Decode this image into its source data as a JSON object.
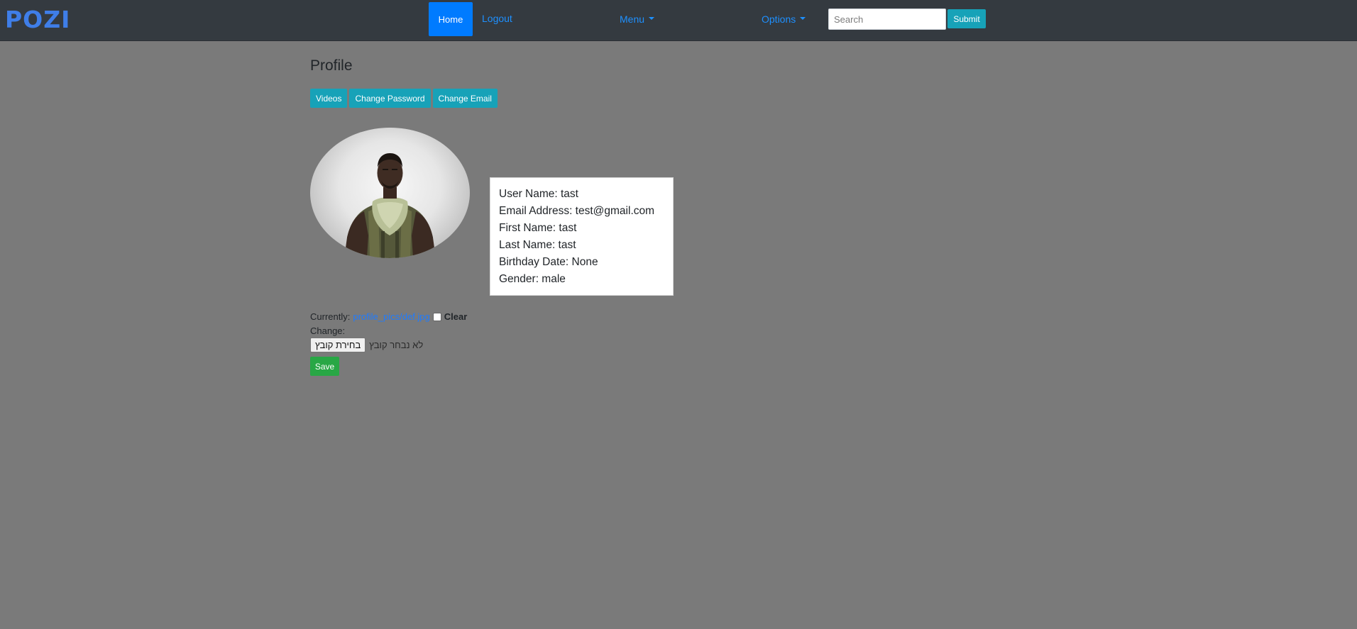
{
  "navbar": {
    "brand": "POZI",
    "home_label": "Home",
    "logout_label": "Logout",
    "menu_label": "Menu",
    "options_label": "Options",
    "search_placeholder": "Search",
    "submit_label": "Submit"
  },
  "profile": {
    "title": "Profile",
    "buttons": {
      "videos": "Videos",
      "change_password": "Change Password",
      "change_email": "Change Email"
    },
    "info": {
      "username": "User Name: tast",
      "email": "Email Address: test@gmail.com",
      "first_name": "First Name: tast",
      "last_name": "Last Name: tast",
      "birthday": "Birthday Date: None",
      "gender": "Gender: male"
    }
  },
  "upload_form": {
    "currently_label": "Currently:",
    "current_file": "profile_pics/def.jpg",
    "clear_label": "Clear",
    "change_label": "Change:",
    "choose_file_label": "בחירת קובץ",
    "no_file_text": "לא נבחר קובץ",
    "save_label": "Save"
  },
  "colors": {
    "navbar_bg": "#343a40",
    "page_bg": "#7a7a7a",
    "primary": "#007bff",
    "info": "#17a2b8",
    "success": "#28a745",
    "brand": "#3f7ee8"
  },
  "icons": {
    "dropdown": "caret-down-icon",
    "avatar": "profile-picture"
  }
}
